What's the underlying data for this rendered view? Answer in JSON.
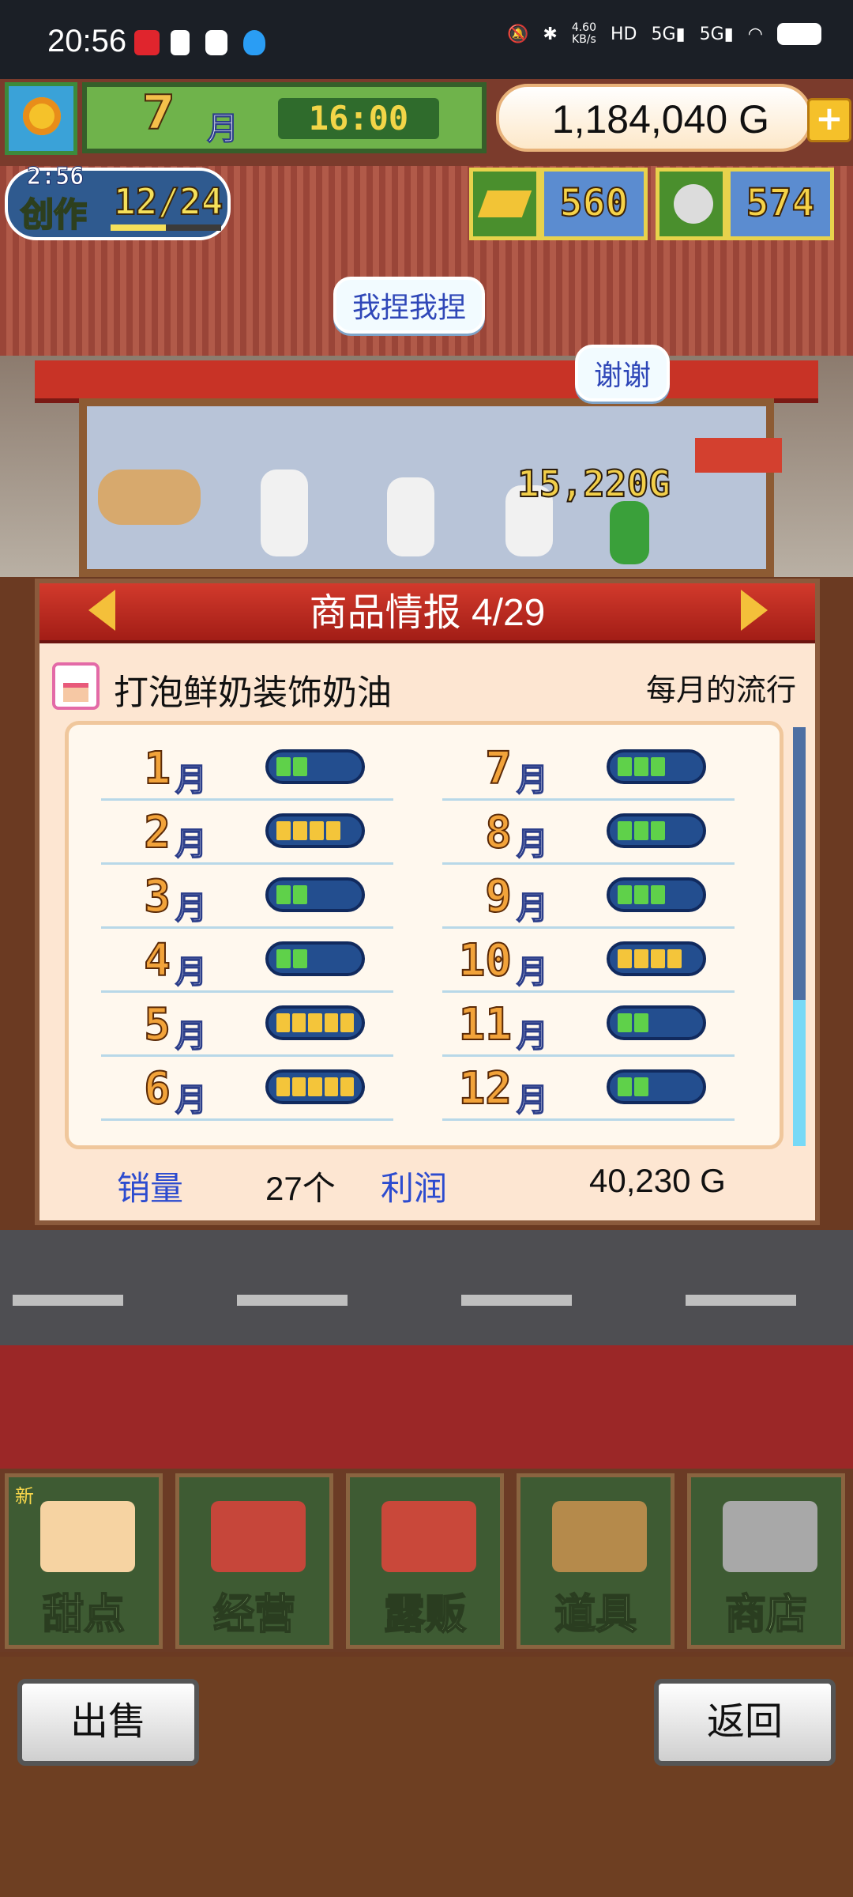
{
  "status_bar": {
    "time": "20:56",
    "net_speed": "4.60\nKB/s",
    "net_top": "4.60",
    "net_bottom": "KB/s"
  },
  "hud": {
    "month": "7",
    "month_unit": "月",
    "clock": "16:00",
    "money": "1,184,040 G",
    "add_label": "+",
    "create": {
      "timer": "2:56",
      "label": "创作",
      "progress": "12/24"
    },
    "gold_count": "560",
    "medal_count": "574"
  },
  "scene": {
    "bubble1": "我捏我捏",
    "bubble2": "谢谢",
    "sale_amount": "15,220G"
  },
  "dialog": {
    "title": "商品情报 4/29",
    "product_name": "打泡鲜奶装饰奶油",
    "trend_label": "每月的流行",
    "months_left": [
      {
        "num": "1",
        "unit": "月",
        "level": 2,
        "color": "green"
      },
      {
        "num": "2",
        "unit": "月",
        "level": 4,
        "color": "yellow"
      },
      {
        "num": "3",
        "unit": "月",
        "level": 2,
        "color": "green"
      },
      {
        "num": "4",
        "unit": "月",
        "level": 2,
        "color": "green"
      },
      {
        "num": "5",
        "unit": "月",
        "level": 5,
        "color": "yellow"
      },
      {
        "num": "6",
        "unit": "月",
        "level": 5,
        "color": "yellow"
      }
    ],
    "months_right": [
      {
        "num": "7",
        "unit": "月",
        "level": 3,
        "color": "green"
      },
      {
        "num": "8",
        "unit": "月",
        "level": 3,
        "color": "green"
      },
      {
        "num": "9",
        "unit": "月",
        "level": 3,
        "color": "green"
      },
      {
        "num": "10",
        "unit": "月",
        "level": 4,
        "color": "yellow"
      },
      {
        "num": "11",
        "unit": "月",
        "level": 2,
        "color": "green"
      },
      {
        "num": "12",
        "unit": "月",
        "level": 2,
        "color": "green"
      }
    ],
    "sales_label": "销量",
    "sales_value": "27个",
    "profit_label": "利润",
    "profit_value": "40,230 G"
  },
  "menu": {
    "new_badge": "新",
    "items": [
      "甜点",
      "经营",
      "露贩",
      "道具",
      "商店"
    ]
  },
  "bottom": {
    "sell": "出售",
    "back": "返回"
  },
  "colors": {
    "green": "#5fd14a",
    "yellow": "#f4c53a"
  }
}
